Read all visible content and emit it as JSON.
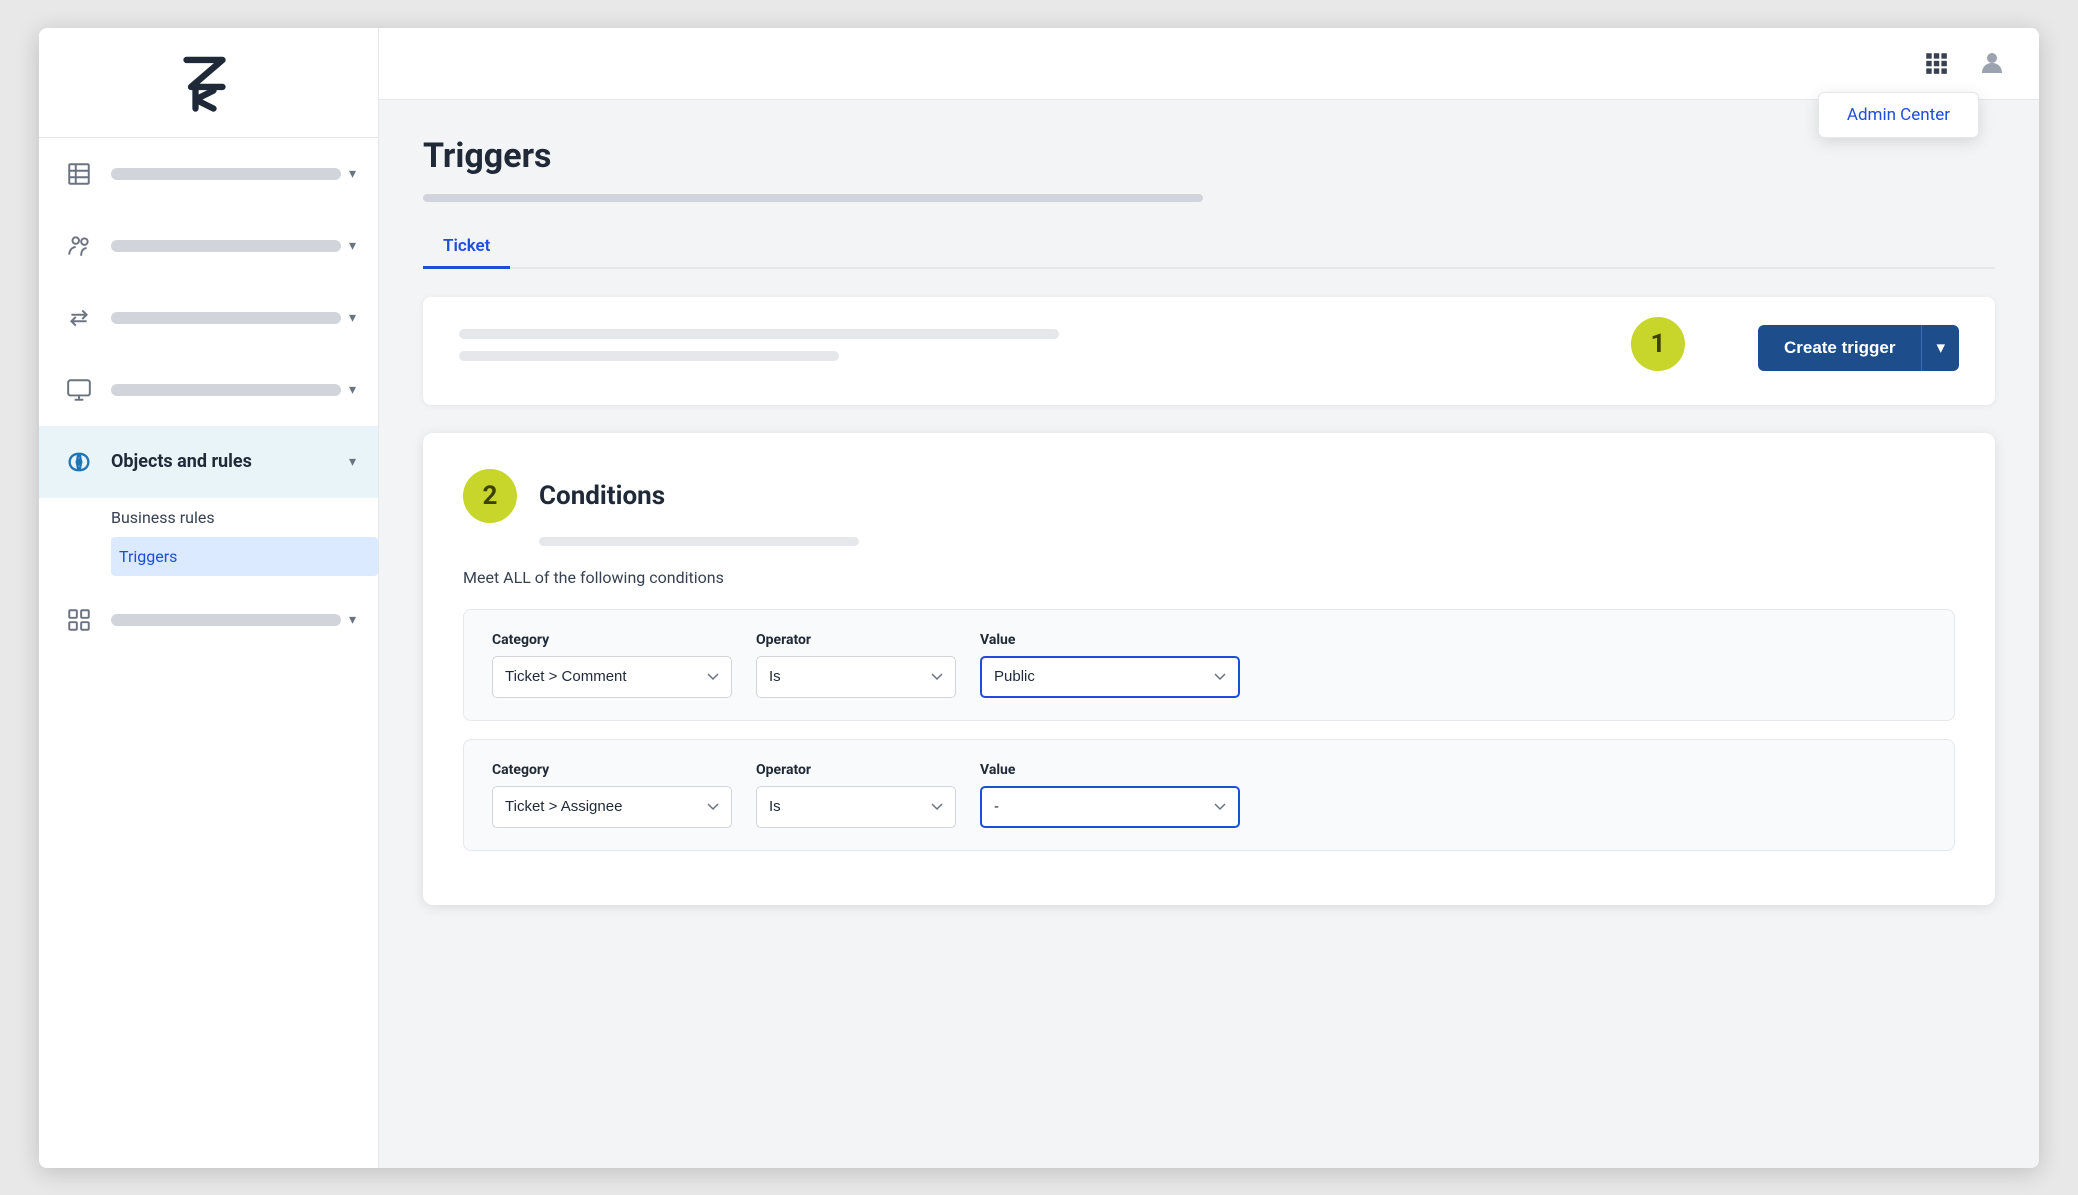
{
  "sidebar": {
    "logo_alt": "Zendesk Logo",
    "nav_items": [
      {
        "id": "workspace",
        "icon": "building-icon",
        "active": false
      },
      {
        "id": "people",
        "icon": "people-icon",
        "active": false
      },
      {
        "id": "transfer",
        "icon": "transfer-icon",
        "active": false
      },
      {
        "id": "screen",
        "icon": "screen-icon",
        "active": false
      },
      {
        "id": "objects-rules",
        "label": "Objects and rules",
        "icon": "objects-rules-icon",
        "active": true
      },
      {
        "id": "apps",
        "icon": "apps-icon",
        "active": false
      }
    ],
    "sub_nav": {
      "parent": "Business rules",
      "active_child": "Triggers"
    }
  },
  "topbar": {
    "grid_icon": "grid-icon",
    "user_icon": "user-icon",
    "admin_center_label": "Admin Center"
  },
  "page": {
    "title": "Triggers",
    "tabs": [
      {
        "label": "Ticket",
        "active": true
      }
    ]
  },
  "step1": {
    "badge_number": "1",
    "create_trigger_label": "Create trigger",
    "chevron_label": "▾"
  },
  "step2": {
    "badge_number": "2",
    "conditions_title": "Conditions",
    "meet_all_text": "Meet ALL of the following conditions",
    "rows": [
      {
        "category_label": "Category",
        "category_value": "Ticket > Comment",
        "operator_label": "Operator",
        "operator_value": "Is",
        "value_label": "Value",
        "value_value": "Public",
        "value_highlighted": true
      },
      {
        "category_label": "Category",
        "category_value": "Ticket > Assignee",
        "operator_label": "Operator",
        "operator_value": "Is",
        "value_label": "Value",
        "value_value": "-",
        "value_highlighted": true
      }
    ]
  }
}
